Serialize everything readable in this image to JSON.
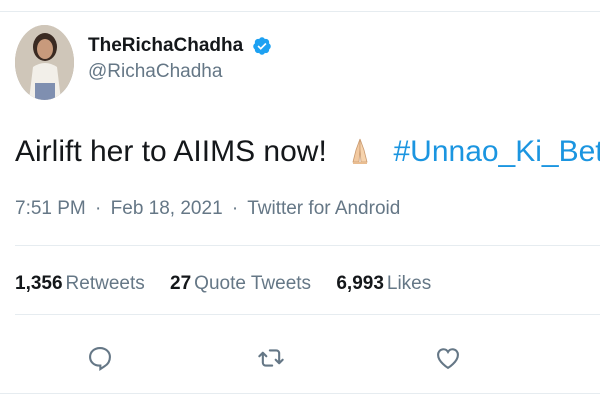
{
  "tweet": {
    "author": {
      "display_name": "TheRichaChadha",
      "handle": "@RichaChadha",
      "verified_icon": "verified-badge-icon",
      "avatar_icon": "profile-avatar"
    },
    "text": {
      "main": "Airlift her to AIIMS now!",
      "emoji": "folded-hands-icon",
      "hashtag": "#Unnao_Ki_Beti"
    },
    "meta": {
      "time": "7:51 PM",
      "separator": "·",
      "date": "Feb 18, 2021",
      "source": "Twitter for Android"
    },
    "stats": [
      {
        "count": "1,356",
        "label": "Retweets"
      },
      {
        "count": "27",
        "label": "Quote Tweets"
      },
      {
        "count": "6,993",
        "label": "Likes"
      }
    ],
    "actions": [
      "reply-icon",
      "retweet-icon",
      "like-icon"
    ],
    "colors": {
      "hashtag": "#1b95e0",
      "secondary_text": "#657786",
      "primary_text": "#14171a",
      "verified": "#1da1f2",
      "divider": "#e6ecf0"
    }
  }
}
